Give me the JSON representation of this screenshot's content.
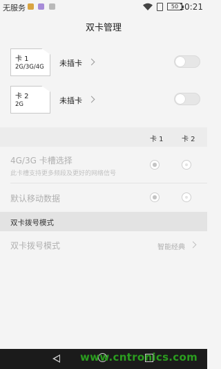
{
  "status_bar": {
    "carrier": "无服务",
    "battery": "50",
    "time": "10:21"
  },
  "header": {
    "title": "双卡管理"
  },
  "sim_cards": [
    {
      "name": "卡 1",
      "type": "2G/3G/4G",
      "status": "未插卡",
      "enabled": false
    },
    {
      "name": "卡 2",
      "type": "2G",
      "status": "未插卡",
      "enabled": false
    }
  ],
  "columns": {
    "card1": "卡 1",
    "card2": "卡 2"
  },
  "settings": {
    "slot_select": {
      "title": "4G/3G 卡槽选择",
      "subtitle": "此卡槽支持更多频段及更好的网络信号",
      "selected": "card1"
    },
    "default_data": {
      "title": "默认移动数据",
      "selected": "card1"
    }
  },
  "dial_section": {
    "header": "双卡拨号模式",
    "item_label": "双卡拨号模式",
    "item_value": "智能经典"
  },
  "watermark": "www.cntronics.com"
}
